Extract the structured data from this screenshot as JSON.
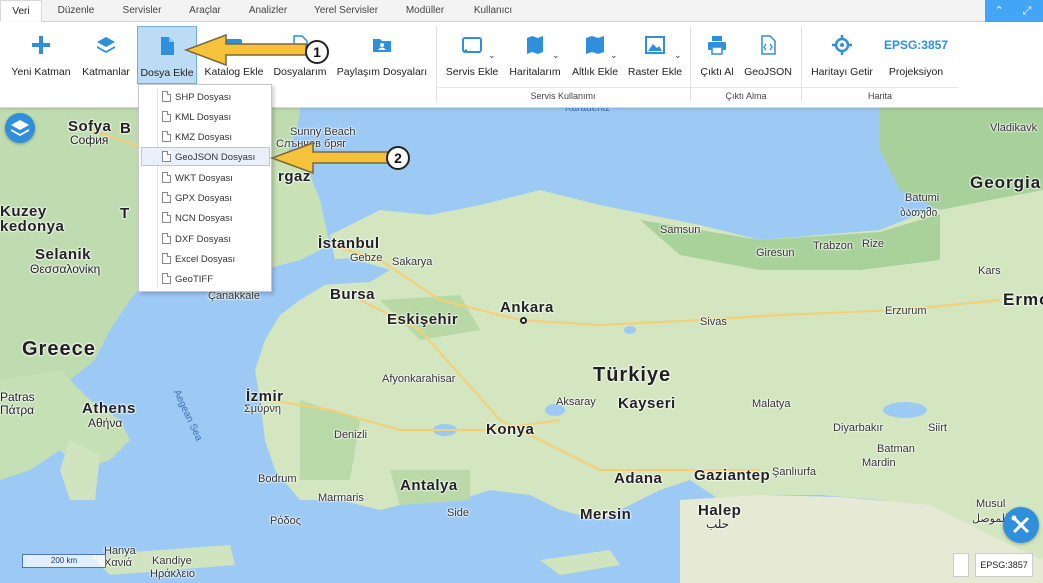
{
  "tabs": [
    {
      "label": "Veri",
      "active": true
    },
    {
      "label": "Düzenle"
    },
    {
      "label": "Servisler"
    },
    {
      "label": "Araçlar"
    },
    {
      "label": "Analizler"
    },
    {
      "label": "Yerel Servisler"
    },
    {
      "label": "Modüller"
    },
    {
      "label": "Kullanıcı"
    }
  ],
  "ribbon": {
    "buttons": {
      "yeni_katman": "Yeni Katman",
      "katmanlar": "Katmanlar",
      "dosya_ekle": "Dosya Ekle",
      "katalog_ekle": "Katalog Ekle",
      "dosyalarim": "Dosyalarım",
      "paylasim": "Paylaşım Dosyaları",
      "servis_ekle": "Servis Ekle",
      "haritalarim": "Haritalarım",
      "altlik_ekle": "Altlık Ekle",
      "raster_ekle": "Raster Ekle",
      "cikti_al": "Çıktı Al",
      "geojson": "GeoJSON",
      "haritayi_getir": "Haritayı Getir",
      "projeksiyon": "Projeksiyon",
      "epsg_label": "EPSG:3857"
    },
    "groups": {
      "servis": "Servis Kullanımı",
      "cikti": "Çıktı Alma",
      "harita": "Harita"
    }
  },
  "dropdown": {
    "items": [
      "SHP Dosyası",
      "KML Dosyası",
      "KMZ Dosyası",
      "GeoJSON Dosyası",
      "WKT Dosyası",
      "GPX Dosyası",
      "NCN Dosyası",
      "DXF Dosyası",
      "Excel Dosyası",
      "GeoTIFF"
    ],
    "highlighted": "GeoJSON Dosyası"
  },
  "callouts": [
    "1",
    "2"
  ],
  "map": {
    "labels": {
      "sofya": "Sofya",
      "sofia_native": "София",
      "kuzey": "Kuzey",
      "kedonya": "kedonya",
      "selanik": "Selanik",
      "thessaloniki": "Θεσσαλονίκη",
      "greece": "Greece",
      "patras": "Patras",
      "patras_native": "Πάτρα",
      "athens": "Athens",
      "athens_native": "Αθήνα",
      "istanbul": "İstanbul",
      "gebze": "Gebze",
      "sakarya": "Sakarya",
      "bursa": "Bursa",
      "canakkale": "Çanakkale",
      "eskisehir": "Eskişehir",
      "ankara": "Ankara",
      "turkiye": "Türkiye",
      "kayseri": "Kayseri",
      "aksaray": "Aksaray",
      "afyon": "Afyonkarahisar",
      "izmir": "İzmir",
      "denizli": "Denizli",
      "konya": "Konya",
      "antalya": "Antalya",
      "adana": "Adana",
      "mersin": "Mersin",
      "gaziantep": "Gaziantep",
      "sanliurfa": "Şanlıurfa",
      "halep": "Halep",
      "halep_native": "حلب",
      "malatya": "Malatya",
      "sivas": "Sivas",
      "erzurum": "Erzurum",
      "diyarbakir": "Diyarbakır",
      "batman": "Batman",
      "mardin": "Mardin",
      "samsun": "Samsun",
      "giresun": "Giresun",
      "trabzon": "Trabzon",
      "rize": "Rize",
      "kars": "Kars",
      "batumi": "Batumi",
      "batumi_native": "ბათუმი",
      "georgia": "Georgia",
      "vladikavkaz": "Vladikavk",
      "erm": "Ermo",
      "bodrum": "Bodrum",
      "marmaris": "Marmaris",
      "side": "Side",
      "aegean": "Aegean Sea",
      "karadeniz": "Karadeniz",
      "hanya": "Hanya",
      "chania": "Χανιά",
      "kandiye": "Kandiye",
      "heraklion": "Ηράκλειο",
      "mosul": "Musul",
      "mosul_native": "الموصل",
      "siirt": "Siirt",
      "rhodes": "Ρόδος",
      "sunny_beach": "Sunny Beach",
      "slanchev_bryag": "Слънчев бряг",
      "burgaz": "rgaz",
      "tzmir_greek": "Σμύρνη",
      "b": "B",
      "t": "T"
    },
    "scale": "200 km",
    "epsg": "EPSG:3857"
  }
}
